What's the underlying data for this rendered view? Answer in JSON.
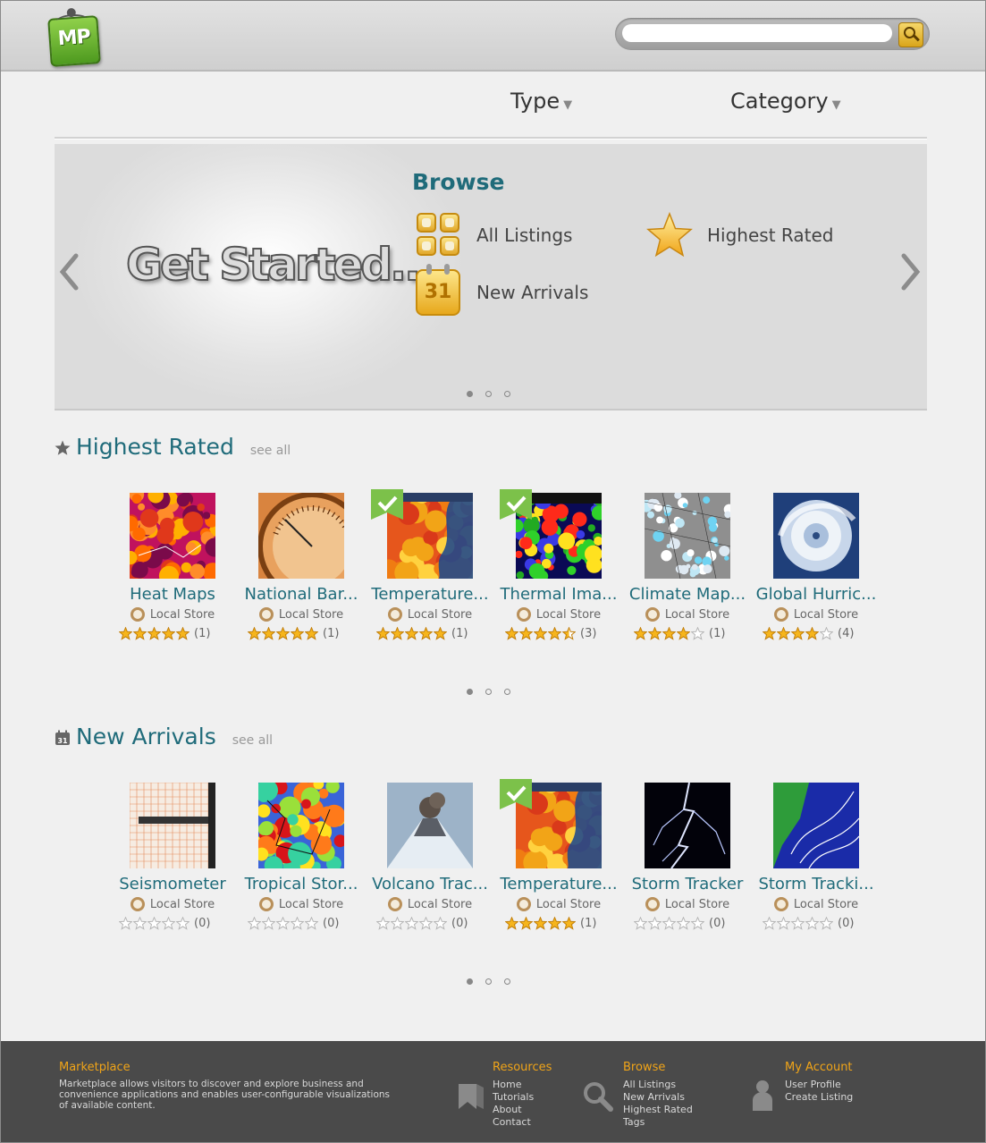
{
  "header": {
    "logo_text": "MP",
    "search_placeholder": "",
    "colors": {
      "accent": "#1f6b7a",
      "footer_heading": "#f0a418",
      "logo_green": "#6cb831"
    }
  },
  "nav": {
    "type_label": "Type",
    "category_label": "Category"
  },
  "hero": {
    "headline": "Get Started...",
    "browse_title": "Browse",
    "links": [
      {
        "label": "All Listings",
        "icon": "grid-icon"
      },
      {
        "label": "Highest Rated",
        "icon": "star-icon"
      },
      {
        "label": "New Arrivals",
        "icon": "calendar-icon"
      }
    ],
    "calendar_number": "31",
    "page_dots": {
      "count": 3,
      "active": 0
    }
  },
  "highest_rated": {
    "title": "Highest Rated",
    "see_all": "see all",
    "items": [
      {
        "name": "Heat Maps",
        "store": "Local Store",
        "rating": 5,
        "count": "(1)",
        "checked": false,
        "thumb": "heatmap"
      },
      {
        "name": "National Bar...",
        "store": "Local Store",
        "rating": 5,
        "count": "(1)",
        "checked": false,
        "thumb": "barometer"
      },
      {
        "name": "Temperature...",
        "store": "Local Store",
        "rating": 5,
        "count": "(1)",
        "checked": true,
        "thumb": "temperature"
      },
      {
        "name": "Thermal Ima...",
        "store": "Local Store",
        "rating": 4.5,
        "count": "(3)",
        "checked": true,
        "thumb": "thermal"
      },
      {
        "name": "Climate Map...",
        "store": "Local Store",
        "rating": 4,
        "count": "(1)",
        "checked": false,
        "thumb": "climate"
      },
      {
        "name": "Global Hurric...",
        "store": "Local Store",
        "rating": 4,
        "count": "(4)",
        "checked": false,
        "thumb": "hurricane"
      }
    ],
    "page_dots": {
      "count": 3,
      "active": 0
    }
  },
  "new_arrivals": {
    "title": "New Arrivals",
    "see_all": "see all",
    "items": [
      {
        "name": "Seismometer",
        "store": "Local Store",
        "rating": 0,
        "count": "(0)",
        "checked": false,
        "thumb": "seismo"
      },
      {
        "name": "Tropical Stor...",
        "store": "Local Store",
        "rating": 0,
        "count": "(0)",
        "checked": false,
        "thumb": "tropical"
      },
      {
        "name": "Volcano Trac...",
        "store": "Local Store",
        "rating": 0,
        "count": "(0)",
        "checked": false,
        "thumb": "volcano"
      },
      {
        "name": "Temperature...",
        "store": "Local Store",
        "rating": 5,
        "count": "(1)",
        "checked": true,
        "thumb": "temperature"
      },
      {
        "name": "Storm Tracker",
        "store": "Local Store",
        "rating": 0,
        "count": "(0)",
        "checked": false,
        "thumb": "lightning"
      },
      {
        "name": "Storm Tracki...",
        "store": "Local Store",
        "rating": 0,
        "count": "(0)",
        "checked": false,
        "thumb": "storm"
      }
    ],
    "page_dots": {
      "count": 3,
      "active": 0
    }
  },
  "footer": {
    "marketplace": {
      "title": "Marketplace",
      "description": [
        "Marketplace allows visitors to discover and explore business and",
        "convenience applications and enables user-configurable visualizations",
        "of available content."
      ]
    },
    "resources": {
      "title": "Resources",
      "links": [
        "Home",
        "Tutorials",
        "About",
        "Contact"
      ]
    },
    "browse": {
      "title": "Browse",
      "links": [
        "All Listings",
        "New Arrivals",
        "Highest Rated",
        "Tags"
      ]
    },
    "account": {
      "title": "My Account",
      "links": [
        "User Profile",
        "Create Listing"
      ]
    }
  }
}
